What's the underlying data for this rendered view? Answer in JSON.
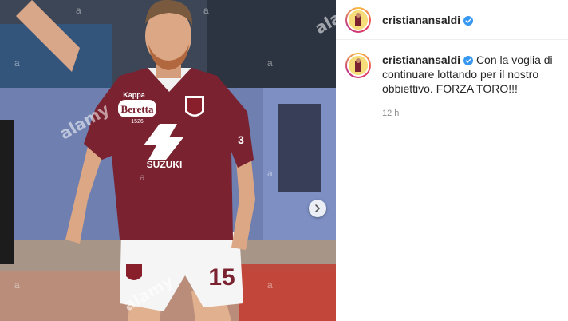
{
  "post": {
    "username": "cristianansaldi",
    "caption": "Con la voglia di continuare lottando per il nostro obbiettivo. FORZA TORO!!!",
    "timestamp": "12 h"
  },
  "photo": {
    "watermark": "alamy",
    "watermark_letter": "a",
    "shirt_sponsor": "Beretta",
    "shirt_sponsor_sub": "1526",
    "shirt_brand": "Kappa",
    "main_sponsor": "SUZUKI",
    "shirt_number": "15",
    "sleeve_number": "3"
  },
  "colors": {
    "verified": "#3897f0",
    "jersey": "#7a2230",
    "text": "#262626",
    "muted": "#8e8e8e"
  },
  "icons": {
    "verified": "verified-badge-icon",
    "next": "chevron-right-icon"
  }
}
